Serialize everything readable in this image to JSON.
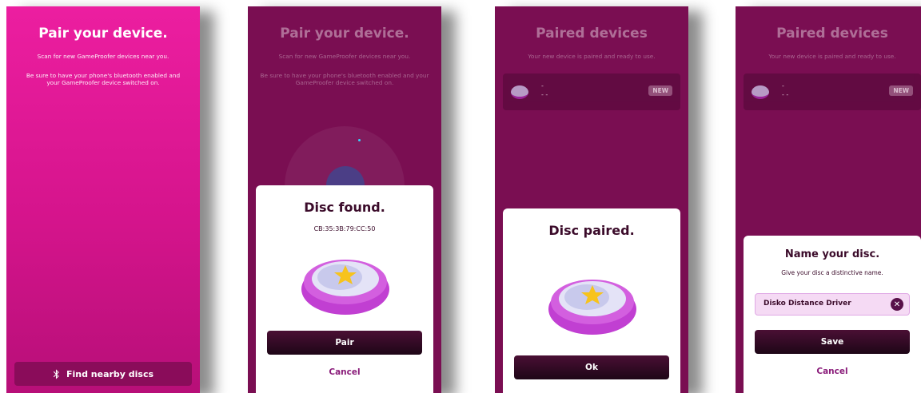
{
  "screen1": {
    "title": "Pair your device.",
    "subtitle1": "Scan for new GameProofer devices near you.",
    "subtitle2": "Be sure to have your phone's bluetooth enabled and your GameProofer device switched on.",
    "find_button": "Find nearby discs",
    "find_icon": "bluetooth-icon"
  },
  "screen2": {
    "title": "Pair your device.",
    "subtitle1": "Scan for new GameProofer devices near you.",
    "subtitle2": "Be sure to have your phone's bluetooth enabled and your GameProofer device switched on.",
    "dialog": {
      "title": "Disc found.",
      "address": "CB:35:3B:79:CC:50",
      "primary": "Pair",
      "secondary": "Cancel"
    }
  },
  "screen3": {
    "title": "Paired devices",
    "subtitle": "Your new device is paired and ready to use.",
    "device": {
      "name": "-",
      "id": "- -",
      "badge": "NEW"
    },
    "dialog": {
      "title": "Disc paired.",
      "primary": "Ok"
    }
  },
  "screen4": {
    "title": "Paired devices",
    "subtitle": "Your new device is paired and ready to use.",
    "device": {
      "name": "-",
      "id": "- -",
      "badge": "NEW"
    },
    "dialog": {
      "title": "Name your disc.",
      "subtitle": "Give your disc a distinctive name.",
      "input_value": "Disko Distance Driver",
      "clear_icon": "close-icon",
      "primary": "Save",
      "secondary": "Cancel"
    }
  },
  "colors": {
    "brand_pink": "#ec1ea0",
    "dark_plum": "#7a0e52",
    "button_dark": "#2a0820",
    "link_purple": "#8a1c7a"
  }
}
